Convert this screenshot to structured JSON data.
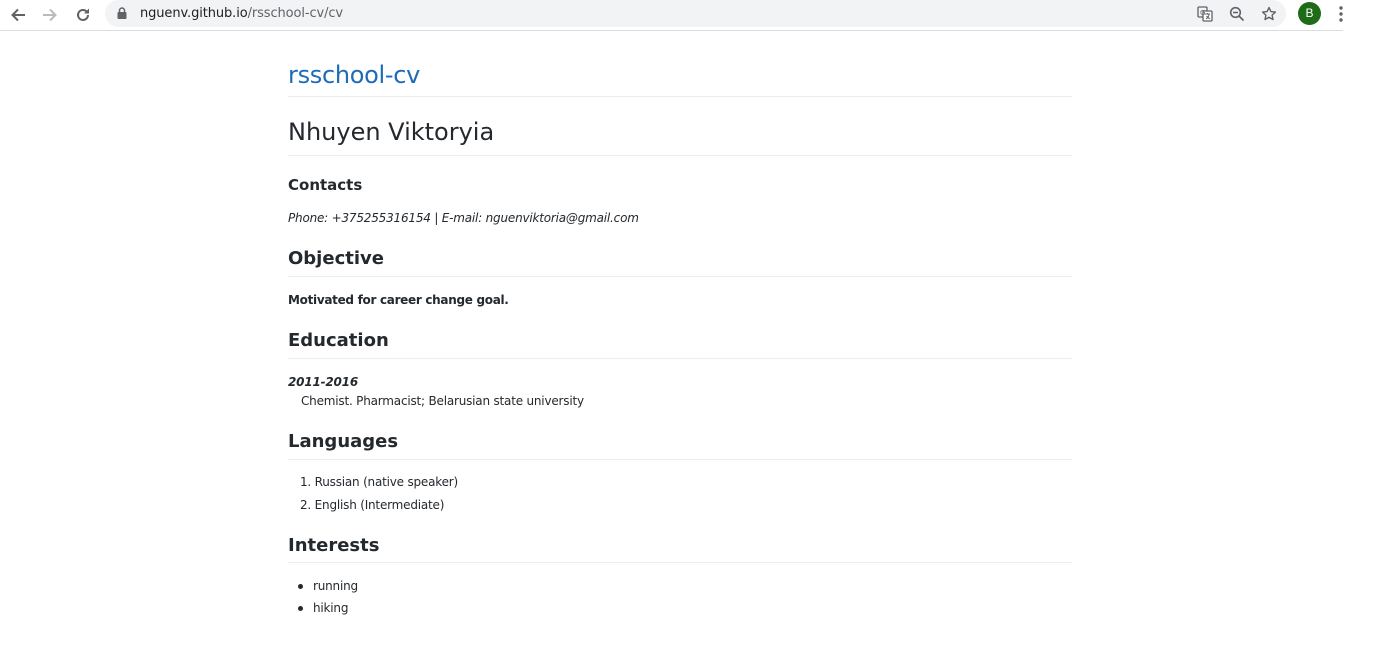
{
  "browser": {
    "url_host": "nguenv.github.io",
    "url_path": "/rsschool-cv/cv",
    "profile_initial": "B",
    "icons": {
      "back": "arrow-left-icon",
      "forward": "arrow-right-icon",
      "reload": "reload-icon",
      "lock": "lock-icon",
      "translate": "translate-icon",
      "zoom": "zoom-out-icon",
      "bookmark": "star-icon",
      "menu": "kebab-menu-icon"
    }
  },
  "page": {
    "site_title": "rsschool-cv",
    "name": "Nhuyen Viktoryia",
    "contacts": {
      "heading": "Contacts",
      "details": "Phone: +375255316154 | E-mail: nguenviktoria@gmail.com"
    },
    "objective": {
      "heading": "Objective",
      "text": "Motivated for career change goal."
    },
    "education": {
      "heading": "Education",
      "period": "2011-2016",
      "description": "Chemist. Pharmacist; Belarusian state university"
    },
    "languages": {
      "heading": "Languages",
      "items": [
        "1. Russian (native speaker)",
        "2. English (Intermediate)"
      ]
    },
    "interests": {
      "heading": "Interests",
      "items": [
        "running",
        "hiking"
      ]
    }
  },
  "colors": {
    "link": "#1e6bb8",
    "text": "#24292e",
    "rule": "#eaecef",
    "omnibox_bg": "#f1f3f4",
    "avatar_bg": "#1e6b18"
  }
}
